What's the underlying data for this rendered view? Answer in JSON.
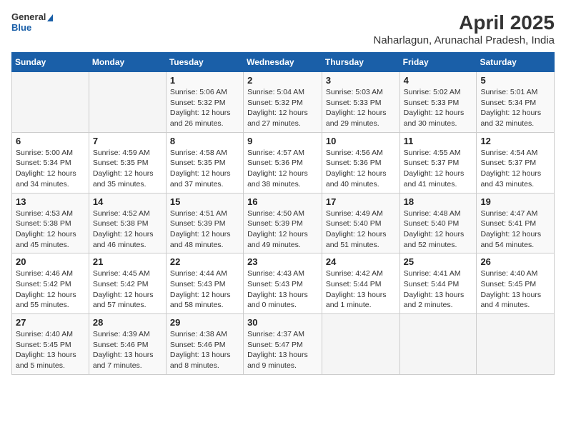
{
  "header": {
    "logo_general": "General",
    "logo_blue": "Blue",
    "title": "April 2025",
    "subtitle": "Naharlagun, Arunachal Pradesh, India"
  },
  "days_of_week": [
    "Sunday",
    "Monday",
    "Tuesday",
    "Wednesday",
    "Thursday",
    "Friday",
    "Saturday"
  ],
  "weeks": [
    [
      {
        "day": "",
        "info": ""
      },
      {
        "day": "",
        "info": ""
      },
      {
        "day": "1",
        "info": "Sunrise: 5:06 AM\nSunset: 5:32 PM\nDaylight: 12 hours and 26 minutes."
      },
      {
        "day": "2",
        "info": "Sunrise: 5:04 AM\nSunset: 5:32 PM\nDaylight: 12 hours and 27 minutes."
      },
      {
        "day": "3",
        "info": "Sunrise: 5:03 AM\nSunset: 5:33 PM\nDaylight: 12 hours and 29 minutes."
      },
      {
        "day": "4",
        "info": "Sunrise: 5:02 AM\nSunset: 5:33 PM\nDaylight: 12 hours and 30 minutes."
      },
      {
        "day": "5",
        "info": "Sunrise: 5:01 AM\nSunset: 5:34 PM\nDaylight: 12 hours and 32 minutes."
      }
    ],
    [
      {
        "day": "6",
        "info": "Sunrise: 5:00 AM\nSunset: 5:34 PM\nDaylight: 12 hours and 34 minutes."
      },
      {
        "day": "7",
        "info": "Sunrise: 4:59 AM\nSunset: 5:35 PM\nDaylight: 12 hours and 35 minutes."
      },
      {
        "day": "8",
        "info": "Sunrise: 4:58 AM\nSunset: 5:35 PM\nDaylight: 12 hours and 37 minutes."
      },
      {
        "day": "9",
        "info": "Sunrise: 4:57 AM\nSunset: 5:36 PM\nDaylight: 12 hours and 38 minutes."
      },
      {
        "day": "10",
        "info": "Sunrise: 4:56 AM\nSunset: 5:36 PM\nDaylight: 12 hours and 40 minutes."
      },
      {
        "day": "11",
        "info": "Sunrise: 4:55 AM\nSunset: 5:37 PM\nDaylight: 12 hours and 41 minutes."
      },
      {
        "day": "12",
        "info": "Sunrise: 4:54 AM\nSunset: 5:37 PM\nDaylight: 12 hours and 43 minutes."
      }
    ],
    [
      {
        "day": "13",
        "info": "Sunrise: 4:53 AM\nSunset: 5:38 PM\nDaylight: 12 hours and 45 minutes."
      },
      {
        "day": "14",
        "info": "Sunrise: 4:52 AM\nSunset: 5:38 PM\nDaylight: 12 hours and 46 minutes."
      },
      {
        "day": "15",
        "info": "Sunrise: 4:51 AM\nSunset: 5:39 PM\nDaylight: 12 hours and 48 minutes."
      },
      {
        "day": "16",
        "info": "Sunrise: 4:50 AM\nSunset: 5:39 PM\nDaylight: 12 hours and 49 minutes."
      },
      {
        "day": "17",
        "info": "Sunrise: 4:49 AM\nSunset: 5:40 PM\nDaylight: 12 hours and 51 minutes."
      },
      {
        "day": "18",
        "info": "Sunrise: 4:48 AM\nSunset: 5:40 PM\nDaylight: 12 hours and 52 minutes."
      },
      {
        "day": "19",
        "info": "Sunrise: 4:47 AM\nSunset: 5:41 PM\nDaylight: 12 hours and 54 minutes."
      }
    ],
    [
      {
        "day": "20",
        "info": "Sunrise: 4:46 AM\nSunset: 5:42 PM\nDaylight: 12 hours and 55 minutes."
      },
      {
        "day": "21",
        "info": "Sunrise: 4:45 AM\nSunset: 5:42 PM\nDaylight: 12 hours and 57 minutes."
      },
      {
        "day": "22",
        "info": "Sunrise: 4:44 AM\nSunset: 5:43 PM\nDaylight: 12 hours and 58 minutes."
      },
      {
        "day": "23",
        "info": "Sunrise: 4:43 AM\nSunset: 5:43 PM\nDaylight: 13 hours and 0 minutes."
      },
      {
        "day": "24",
        "info": "Sunrise: 4:42 AM\nSunset: 5:44 PM\nDaylight: 13 hours and 1 minute."
      },
      {
        "day": "25",
        "info": "Sunrise: 4:41 AM\nSunset: 5:44 PM\nDaylight: 13 hours and 2 minutes."
      },
      {
        "day": "26",
        "info": "Sunrise: 4:40 AM\nSunset: 5:45 PM\nDaylight: 13 hours and 4 minutes."
      }
    ],
    [
      {
        "day": "27",
        "info": "Sunrise: 4:40 AM\nSunset: 5:45 PM\nDaylight: 13 hours and 5 minutes."
      },
      {
        "day": "28",
        "info": "Sunrise: 4:39 AM\nSunset: 5:46 PM\nDaylight: 13 hours and 7 minutes."
      },
      {
        "day": "29",
        "info": "Sunrise: 4:38 AM\nSunset: 5:46 PM\nDaylight: 13 hours and 8 minutes."
      },
      {
        "day": "30",
        "info": "Sunrise: 4:37 AM\nSunset: 5:47 PM\nDaylight: 13 hours and 9 minutes."
      },
      {
        "day": "",
        "info": ""
      },
      {
        "day": "",
        "info": ""
      },
      {
        "day": "",
        "info": ""
      }
    ]
  ]
}
